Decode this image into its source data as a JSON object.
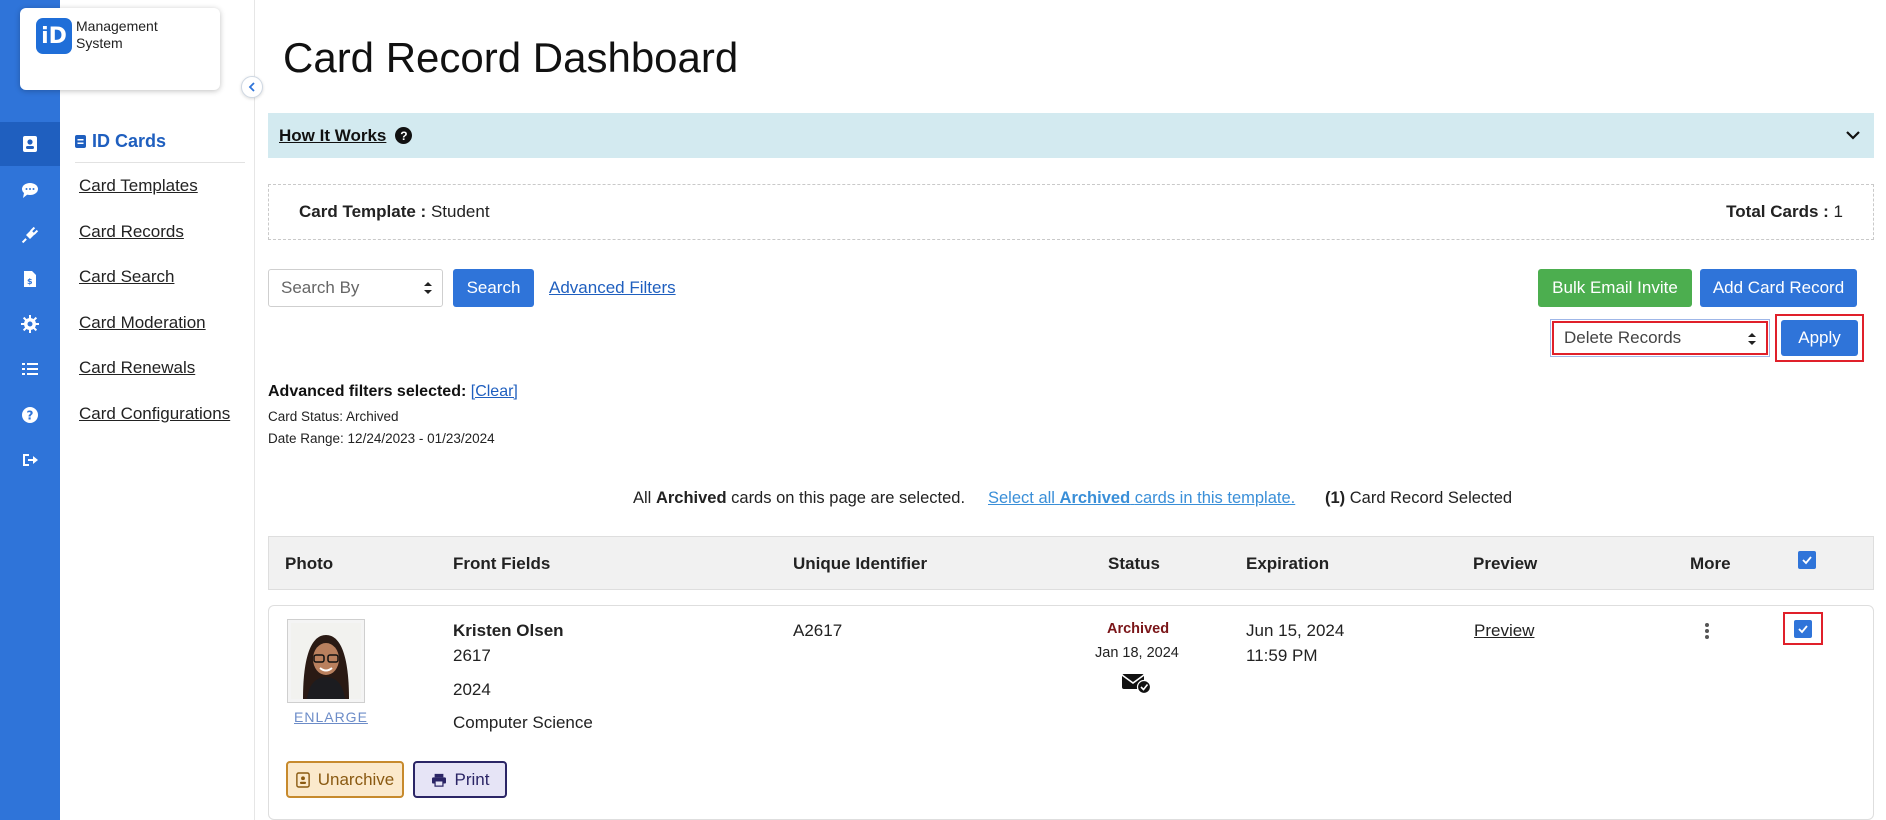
{
  "app": {
    "logo_text": "iD",
    "logo_name": "Management System",
    "rail_icons": [
      "id-card-icon",
      "chat-icon",
      "plug-icon",
      "invoice-icon",
      "gear-icon",
      "list-icon",
      "help-icon",
      "logout-icon"
    ]
  },
  "sidebar": {
    "section_title": "ID Cards",
    "items": [
      {
        "label": "Card Templates"
      },
      {
        "label": "Card Records"
      },
      {
        "label": "Card Search"
      },
      {
        "label": "Card Moderation"
      },
      {
        "label": "Card Renewals"
      },
      {
        "label": "Card Configurations"
      }
    ]
  },
  "page": {
    "title": "Card Record Dashboard",
    "how_it_works": "How It Works",
    "help_glyph": "?"
  },
  "template_info": {
    "template_label": "Card Template :",
    "template_value": "Student",
    "total_label": "Total Cards :",
    "total_value": "1"
  },
  "toolbar": {
    "search_by_placeholder": "Search By",
    "search_button": "Search",
    "advanced_filters_link": "Advanced Filters",
    "bulk_email_button": "Bulk Email Invite",
    "add_record_button": "Add Card Record",
    "bulk_action_selected": "Delete Records",
    "apply_button": "Apply"
  },
  "filters": {
    "heading": "Advanced filters selected:",
    "clear_link": "[Clear]",
    "status_line": "Card Status: Archived",
    "date_line": "Date Range: 12/24/2023 - 01/23/2024"
  },
  "selection": {
    "all_prefix": "All",
    "status_word": "Archived",
    "page_suffix": "cards on this page are selected.",
    "select_all_prefix": "Select all",
    "select_all_suffix": "cards in this template.",
    "count": "(1)",
    "count_suffix": "Card Record Selected"
  },
  "table": {
    "headers": {
      "photo": "Photo",
      "front_fields": "Front Fields",
      "unique_id": "Unique Identifier",
      "status": "Status",
      "expiration": "Expiration",
      "preview": "Preview",
      "more": "More"
    },
    "rows": [
      {
        "enlarge": "ENLARGE",
        "name": "Kristen Olsen",
        "field_2": "2617",
        "field_3": "2024",
        "field_4": "Computer Science",
        "unique_id": "A2617",
        "status": "Archived",
        "status_date": "Jan 18, 2024",
        "expiration_date": "Jun 15, 2024",
        "expiration_time": "11:59 PM",
        "preview": "Preview",
        "unarchive_button": "Unarchive",
        "print_button": "Print",
        "selected": true
      }
    ]
  },
  "colors": {
    "brand_blue": "#2f74d9",
    "success_green": "#4cae4f",
    "highlight_red": "#e0202a",
    "info_bar": "#d3eaf0",
    "archived_text": "#7a1518"
  }
}
